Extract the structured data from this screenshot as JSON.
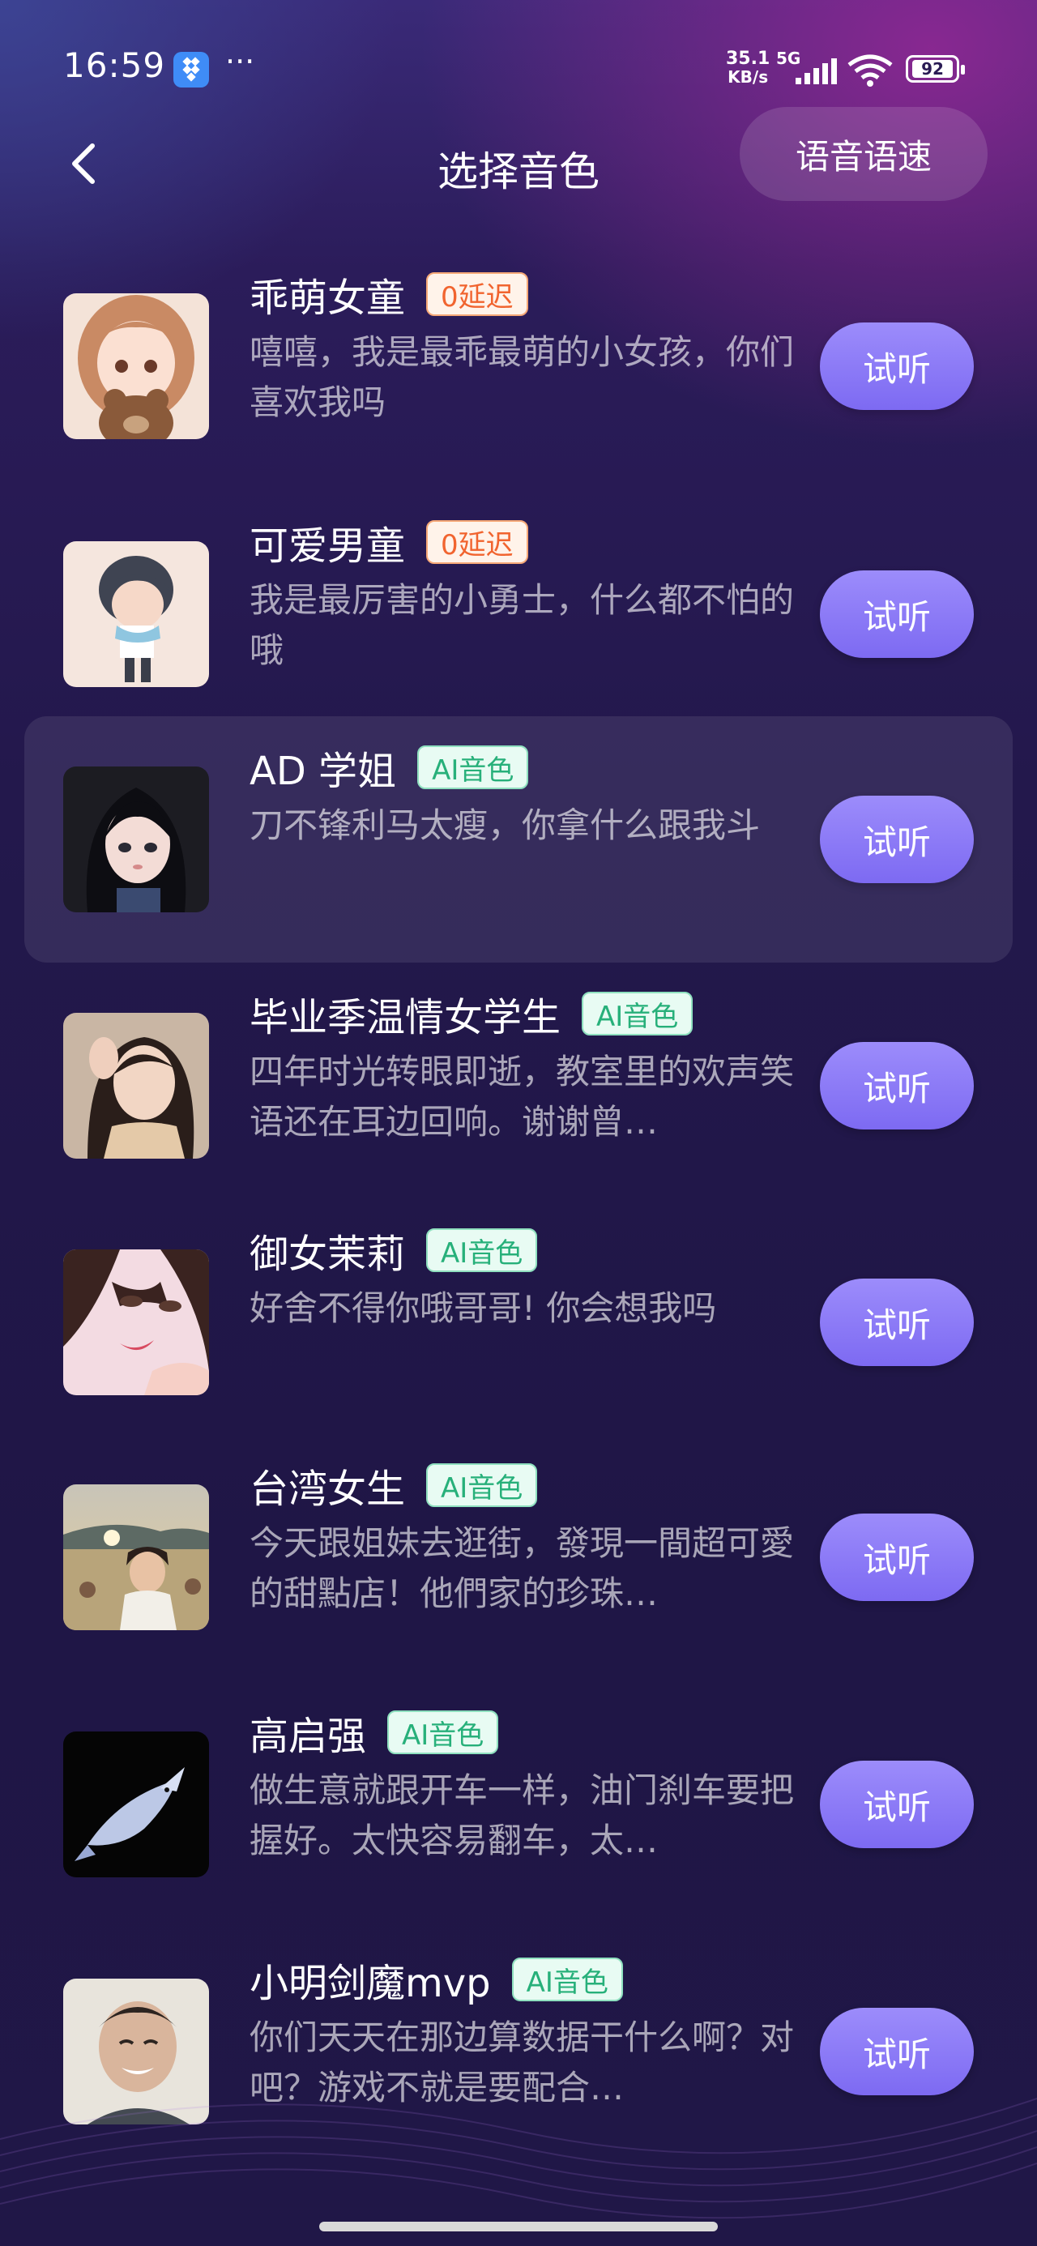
{
  "status_bar": {
    "time": "16:59",
    "more": "···",
    "net_speed_value": "35.1",
    "net_speed_unit": "KB/s",
    "network_type": "5G",
    "battery": "92"
  },
  "header": {
    "title": "选择音色",
    "speed_button": "语音语速"
  },
  "voices": [
    {
      "name": "乖萌女童",
      "tag": "0延迟",
      "tag_type": "delay",
      "desc": "嘻嘻，我是最乖最萌的小女孩，你们喜欢我吗",
      "action": "试听",
      "avatar": "girl-with-bear-avatar"
    },
    {
      "name": "可爱男童",
      "tag": "0延迟",
      "tag_type": "delay",
      "desc": "我是最厉害的小勇士，什么都不怕的哦",
      "action": "试听",
      "avatar": "anime-boy-avatar"
    },
    {
      "name": "AD 学姐",
      "tag": "AI音色",
      "tag_type": "ai",
      "desc": "刀不锋利马太瘦，你拿什么跟我斗",
      "action": "试听",
      "avatar": "anime-girl-black-hair-avatar",
      "selected": true
    },
    {
      "name": "毕业季温情女学生",
      "tag": "AI音色",
      "tag_type": "ai",
      "desc": "四年时光转眼即逝，教室里的欢声笑语还在耳边回响。谢谢曾…",
      "action": "试听",
      "avatar": "girl-photo-avatar"
    },
    {
      "name": "御女茉莉",
      "tag": "AI音色",
      "tag_type": "ai",
      "desc": "好舍不得你哦哥哥! 你会想我吗",
      "action": "试听",
      "avatar": "anime-woman-avatar"
    },
    {
      "name": "台湾女生",
      "tag": "AI音色",
      "tag_type": "ai",
      "desc": "今天跟姐妹去逛街，發現一間超可愛的甜點店！他們家的珍珠…",
      "action": "试听",
      "avatar": "beach-photo-avatar"
    },
    {
      "name": "高启强",
      "tag": "AI音色",
      "tag_type": "ai",
      "desc": "做生意就跟开车一样，油门刹车要把握好。太快容易翻车，太…",
      "action": "试听",
      "avatar": "fish-avatar"
    },
    {
      "name": "小明剑魔mvp",
      "tag": "AI音色",
      "tag_type": "ai",
      "desc": "你们天天在那边算数据干什么啊？对吧？游戏不就是要配合…",
      "action": "试听",
      "avatar": "man-photo-avatar"
    }
  ]
}
